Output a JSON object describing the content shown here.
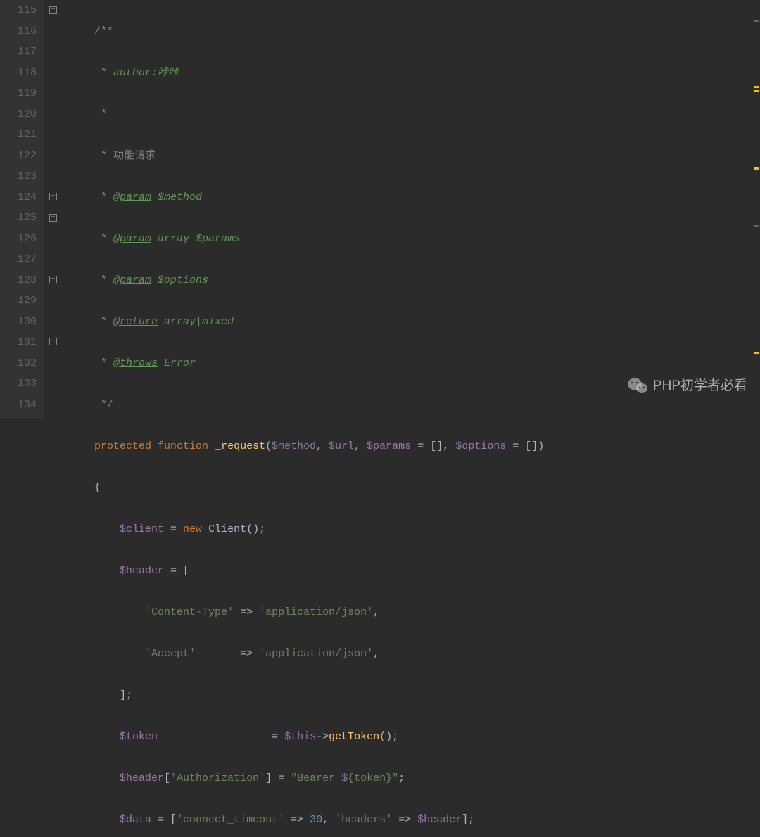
{
  "line_numbers": [
    "115",
    "116",
    "117",
    "118",
    "119",
    "120",
    "121",
    "122",
    "123",
    "124",
    "125",
    "126",
    "127",
    "128",
    "129",
    "130",
    "131",
    "132",
    "133",
    "134"
  ],
  "code": {
    "l115": "/**",
    "l116_prefix": " * ",
    "l116_text": "author:咔咔",
    "l117": " *",
    "l118_prefix": " * ",
    "l118_text": "功能请求",
    "l119_prefix": " * ",
    "l119_tag": "@param",
    "l119_var": " $method",
    "l120_prefix": " * ",
    "l120_tag": "@param",
    "l120_rest": " array $params",
    "l121_prefix": " * ",
    "l121_tag": "@param",
    "l121_var": " $options",
    "l122_prefix": " * ",
    "l122_tag": "@return",
    "l122_rest": " array|mixed",
    "l123_prefix": " * ",
    "l123_tag": "@throws",
    "l123_rest": " Error",
    "l124": " */",
    "l125_kw1": "protected",
    "l125_kw2": "function",
    "l125_fn": "_request",
    "l125_p1": "$method",
    "l125_p2": "$url",
    "l125_p3": "$params",
    "l125_p4": "$options",
    "l126": "{",
    "l127_var": "$client",
    "l127_kw": "new",
    "l127_class": "Client",
    "l128_var": "$header",
    "l129_key": "'Content-Type'",
    "l129_val": "'application/json'",
    "l130_key": "'Accept'",
    "l130_val": "'application/json'",
    "l131": "];",
    "l132_var": "$token",
    "l132_this": "$this",
    "l132_method": "getToken",
    "l133_var": "$header",
    "l133_key": "'Authorization'",
    "l133_str1": "\"Bearer ",
    "l133_interp_var": "{token}",
    "l133_str2": "\"",
    "l134_var": "$data",
    "l134_key1": "'connect_timeout'",
    "l134_num": "30",
    "l134_key2": "'headers'",
    "l134_var2": "$header"
  },
  "watermark": {
    "text": "PHP初学者必看"
  }
}
